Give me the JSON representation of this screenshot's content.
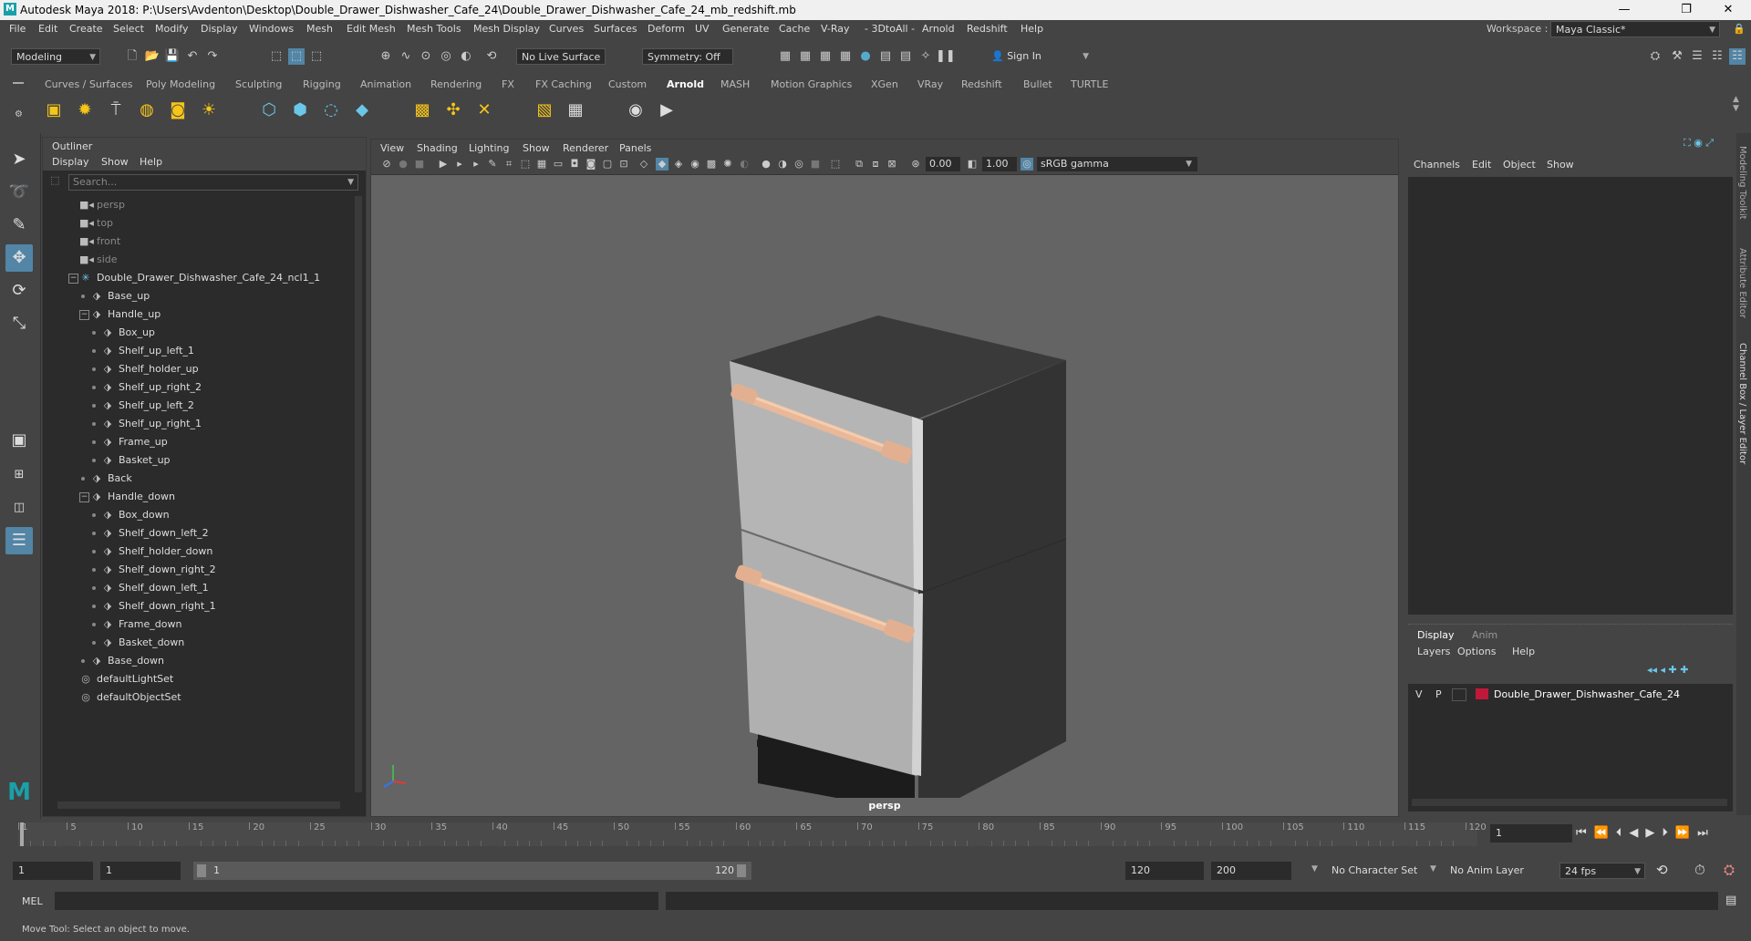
{
  "window": {
    "title": "Autodesk Maya 2018: P:\\Users\\Avdenton\\Desktop\\Double_Drawer_Dishwasher_Cafe_24\\Double_Drawer_Dishwasher_Cafe_24_mb_redshift.mb",
    "minimize": "—",
    "maximize": "❐",
    "close": "✕"
  },
  "menubar": [
    "File",
    "Edit",
    "Create",
    "Select",
    "Modify",
    "Display",
    "Windows",
    "Mesh",
    "Edit Mesh",
    "Mesh Tools",
    "Mesh Display",
    "Curves",
    "Surfaces",
    "Deform",
    "UV",
    "Generate",
    "Cache",
    "V-Ray",
    "- 3DtoAll -",
    "Arnold",
    "Redshift",
    "Help"
  ],
  "workspace": {
    "label": "Workspace :",
    "value": "Maya Classic*"
  },
  "statusline": {
    "mode": "Modeling",
    "live_surface": "No Live Surface",
    "symmetry": "Symmetry: Off",
    "sign_in": "Sign In"
  },
  "shelf": {
    "tabs": [
      "Curves / Surfaces",
      "Poly Modeling",
      "Sculpting",
      "Rigging",
      "Animation",
      "Rendering",
      "FX",
      "FX Caching",
      "Custom",
      "Arnold",
      "MASH",
      "Motion Graphics",
      "XGen",
      "VRay",
      "Redshift",
      "Bullet",
      "TURTLE"
    ],
    "active_tab": "Arnold"
  },
  "outliner": {
    "title": "Outliner",
    "menu": [
      "Display",
      "Show",
      "Help"
    ],
    "search_placeholder": "Search...",
    "items": [
      {
        "label": "persp",
        "type": "camera",
        "depth": 0
      },
      {
        "label": "top",
        "type": "camera",
        "depth": 0
      },
      {
        "label": "front",
        "type": "camera",
        "depth": 0
      },
      {
        "label": "side",
        "type": "camera",
        "depth": 0
      },
      {
        "label": "Double_Drawer_Dishwasher_Cafe_24_ncl1_1",
        "type": "group",
        "depth": 0,
        "expanded": true
      },
      {
        "label": "Base_up",
        "type": "mesh",
        "depth": 1
      },
      {
        "label": "Handle_up",
        "type": "mesh",
        "depth": 1,
        "expanded": true
      },
      {
        "label": "Box_up",
        "type": "mesh",
        "depth": 2
      },
      {
        "label": "Shelf_up_left_1",
        "type": "mesh",
        "depth": 2
      },
      {
        "label": "Shelf_holder_up",
        "type": "mesh",
        "depth": 2
      },
      {
        "label": "Shelf_up_right_2",
        "type": "mesh",
        "depth": 2
      },
      {
        "label": "Shelf_up_left_2",
        "type": "mesh",
        "depth": 2
      },
      {
        "label": "Shelf_up_right_1",
        "type": "mesh",
        "depth": 2
      },
      {
        "label": "Frame_up",
        "type": "mesh",
        "depth": 2
      },
      {
        "label": "Basket_up",
        "type": "mesh",
        "depth": 2
      },
      {
        "label": "Back",
        "type": "mesh",
        "depth": 1
      },
      {
        "label": "Handle_down",
        "type": "mesh",
        "depth": 1,
        "expanded": true
      },
      {
        "label": "Box_down",
        "type": "mesh",
        "depth": 2
      },
      {
        "label": "Shelf_down_left_2",
        "type": "mesh",
        "depth": 2
      },
      {
        "label": "Shelf_holder_down",
        "type": "mesh",
        "depth": 2
      },
      {
        "label": "Shelf_down_right_2",
        "type": "mesh",
        "depth": 2
      },
      {
        "label": "Shelf_down_left_1",
        "type": "mesh",
        "depth": 2
      },
      {
        "label": "Shelf_down_right_1",
        "type": "mesh",
        "depth": 2
      },
      {
        "label": "Frame_down",
        "type": "mesh",
        "depth": 2
      },
      {
        "label": "Basket_down",
        "type": "mesh",
        "depth": 2
      },
      {
        "label": "Base_down",
        "type": "mesh",
        "depth": 1
      },
      {
        "label": "defaultLightSet",
        "type": "set",
        "depth": 0
      },
      {
        "label": "defaultObjectSet",
        "type": "set",
        "depth": 0
      }
    ]
  },
  "viewport": {
    "menu": [
      "View",
      "Shading",
      "Lighting",
      "Show",
      "Renderer",
      "Panels"
    ],
    "exposure": "0.00",
    "gamma": "1.00",
    "color_space": "sRGB gamma",
    "camera_label": "persp"
  },
  "channelbox": {
    "menu": [
      "Channels",
      "Edit",
      "Object",
      "Show"
    ]
  },
  "layers": {
    "tabs": [
      "Display",
      "Anim"
    ],
    "menu": [
      "Layers",
      "Options",
      "Help"
    ],
    "rows": [
      {
        "v": "V",
        "p": "P",
        "name": "Double_Drawer_Dishwasher_Cafe_24",
        "color": "#c0183a"
      }
    ]
  },
  "right_tabs": [
    "Modeling Toolkit",
    "Attribute Editor",
    "Channel Box / Layer Editor"
  ],
  "timeline": {
    "ticks": [
      1,
      5,
      10,
      15,
      20,
      25,
      30,
      35,
      40,
      45,
      50,
      55,
      60,
      65,
      70,
      75,
      80,
      85,
      90,
      95,
      100,
      105,
      110,
      115,
      120
    ],
    "current_frame": "1"
  },
  "range": {
    "start": "1",
    "playback_start": "1",
    "slider_start": "1",
    "slider_end": "120",
    "playback_end": "120",
    "end": "200",
    "character_set": "No Character Set",
    "anim_layer": "No Anim Layer",
    "fps": "24 fps"
  },
  "cmdline": {
    "label": "MEL"
  },
  "helpline": {
    "text": "Move Tool: Select an object to move."
  }
}
